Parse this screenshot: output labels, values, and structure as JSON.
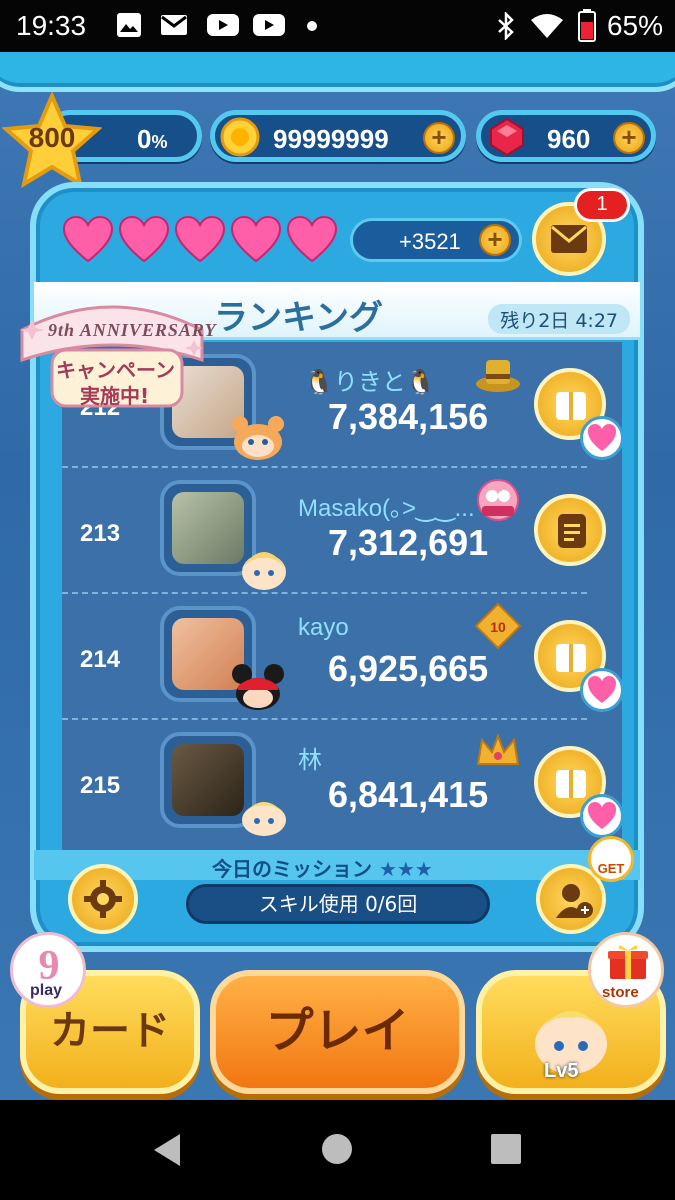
{
  "status_bar": {
    "time": "19:33",
    "battery_percent": "65%",
    "icons": [
      "image-icon",
      "mail-icon",
      "youtube-icon",
      "youtube-icon",
      "dot-icon",
      "bluetooth-icon",
      "wifi-icon",
      "battery-icon"
    ]
  },
  "header": {
    "level": "800",
    "exp_percent": "0",
    "exp_suffix": "%",
    "coins": "99999999",
    "gems": "960"
  },
  "hearts": {
    "count": 5,
    "bonus": "+3521"
  },
  "mail": {
    "badge": "1"
  },
  "ranking": {
    "title": "ランキング",
    "remaining": "残り2日 4:27",
    "rows": [
      {
        "rank": "212",
        "name": "🐧りきと🐧",
        "score": "7,384,156",
        "action": "send-heart"
      },
      {
        "rank": "213",
        "name": "Masako(｡>‿‿...",
        "score": "7,312,691",
        "action": "view-card"
      },
      {
        "rank": "214",
        "name": "kayo",
        "score": "6,925,665",
        "action": "send-heart"
      },
      {
        "rank": "215",
        "name": "林",
        "score": "6,841,415",
        "action": "send-heart"
      }
    ]
  },
  "campaign": {
    "line1": "9th ANNIVERSARY",
    "line2": "キャンペーン",
    "line3": "実施中!"
  },
  "mission": {
    "title": "今日のミッション",
    "stars": "★★★",
    "task": "スキル使用 0/6回"
  },
  "get_label": "GET",
  "bottom": {
    "card_label": "カード",
    "play_label": "プレイ",
    "play9_label": "play",
    "store_label": "store",
    "char_level": "Lv5"
  },
  "colors": {
    "panel": "#2ba9e0",
    "list_bg": "#3b70a8",
    "gold": "#f2b01c",
    "play_orange": "#f27612",
    "name_cyan": "#8fe0ff"
  }
}
